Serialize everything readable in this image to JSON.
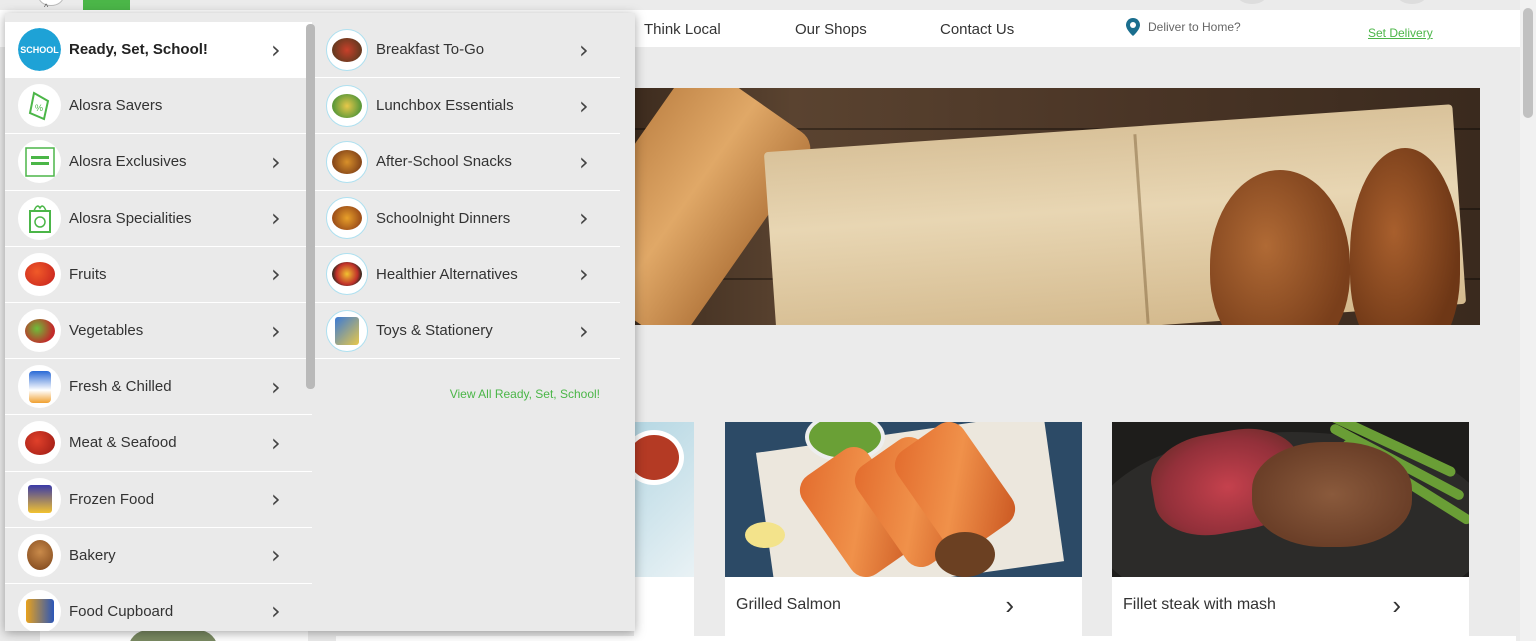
{
  "nav": {
    "links": [
      "Think Local",
      "Our Shops",
      "Contact Us"
    ],
    "deliver_label": "Deliver to Home?",
    "set_delivery": "Set Delivery"
  },
  "menu": {
    "categories": [
      {
        "label": "Ready, Set, School!",
        "icon": "school-icon",
        "active": true,
        "has_arrow": true
      },
      {
        "label": "Alosra Savers",
        "icon": "price-tag-icon",
        "active": false,
        "has_arrow": false
      },
      {
        "label": "Alosra Exclusives",
        "icon": "alosra-exclusives-icon",
        "active": false,
        "has_arrow": true
      },
      {
        "label": "Alosra Specialities",
        "icon": "grocery-bag-icon",
        "active": false,
        "has_arrow": true
      },
      {
        "label": "Fruits",
        "icon": "fruits-icon",
        "active": false,
        "has_arrow": true
      },
      {
        "label": "Vegetables",
        "icon": "vegetables-icon",
        "active": false,
        "has_arrow": true
      },
      {
        "label": "Fresh & Chilled",
        "icon": "dairy-icon",
        "active": false,
        "has_arrow": true
      },
      {
        "label": "Meat & Seafood",
        "icon": "meat-icon",
        "active": false,
        "has_arrow": true
      },
      {
        "label": "Frozen Food",
        "icon": "frozen-food-icon",
        "active": false,
        "has_arrow": true
      },
      {
        "label": "Bakery",
        "icon": "bakery-icon",
        "active": false,
        "has_arrow": true
      },
      {
        "label": "Food Cupboard",
        "icon": "food-cupboard-icon",
        "active": false,
        "has_arrow": true
      }
    ],
    "subcategories": [
      {
        "label": "Breakfast To-Go",
        "icon": "breakfast-icon"
      },
      {
        "label": "Lunchbox Essentials",
        "icon": "lunchbox-icon"
      },
      {
        "label": "After-School Snacks",
        "icon": "snacks-icon"
      },
      {
        "label": "Schoolnight Dinners",
        "icon": "dinner-icon"
      },
      {
        "label": "Healthier Alternatives",
        "icon": "healthy-icon"
      },
      {
        "label": "Toys & Stationery",
        "icon": "toys-icon"
      }
    ],
    "view_all": "View All Ready, Set, School!",
    "school_logo_text": "SCHOOL"
  },
  "recipes": [
    {
      "title": "Grilled Salmon"
    },
    {
      "title": "Fillet steak with mash"
    }
  ],
  "colors": {
    "accent_green": "#4bb648",
    "school_blue": "#1ea2d6"
  }
}
